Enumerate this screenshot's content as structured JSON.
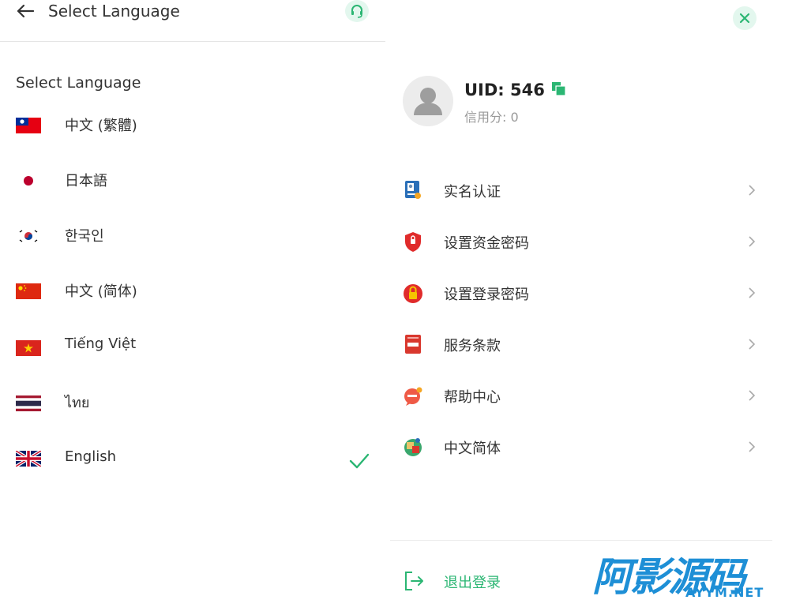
{
  "left": {
    "header_title": "Select Language",
    "section_title": "Select Language",
    "languages": [
      {
        "label": "中文 (繁體)",
        "flag": "taiwan-flag-icon"
      },
      {
        "label": "日本語",
        "flag": "japan-flag-icon"
      },
      {
        "label": "한국인",
        "flag": "korea-flag-icon"
      },
      {
        "label": "中文 (简体)",
        "flag": "china-flag-icon"
      },
      {
        "label": "Tiếng Việt",
        "flag": "vietnam-flag-icon"
      },
      {
        "label": "ไทย",
        "flag": "thailand-flag-icon"
      },
      {
        "label": "English",
        "flag": "uk-flag-icon",
        "selected": true
      }
    ]
  },
  "right": {
    "uid_label": "UID: 546",
    "credit_label": "信用分: 0",
    "menu": [
      {
        "label": "实名认证",
        "icon": "id-card-icon"
      },
      {
        "label": "设置资金密码",
        "icon": "shield-icon"
      },
      {
        "label": "设置登录密码",
        "icon": "lock-icon"
      },
      {
        "label": "服务条款",
        "icon": "terms-book-icon"
      },
      {
        "label": "帮助中心",
        "icon": "help-bubble-icon"
      },
      {
        "label": "中文简体",
        "icon": "language-globe-icon"
      }
    ],
    "logout_label": "退出登录",
    "watermark_main": "阿影源码",
    "watermark_sub": "AYYM.NET"
  },
  "colors": {
    "accent": "#2bb673",
    "accent_light": "#e3f7ee",
    "watermark": "#1e8fd6"
  }
}
